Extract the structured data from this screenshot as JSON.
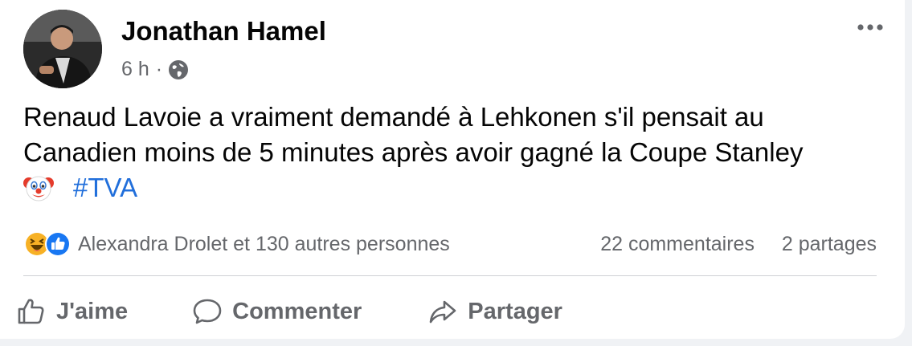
{
  "post": {
    "author": "Jonathan Hamel",
    "time": "6 h",
    "separator": "·",
    "text_line1": "Renaud Lavoie a vraiment demandé à Lehkonen s'il pensait au",
    "text_line2": "Canadien moins de 5 minutes après avoir gagné la Coupe Stanley",
    "hashtag": "#TVA"
  },
  "reactions": {
    "names": "Alexandra Drolet et 130 autres personnes",
    "comments": "22 commentaires",
    "shares": "2 partages"
  },
  "actions": {
    "like": "J'aime",
    "comment": "Commenter",
    "share": "Partager"
  },
  "icons": {
    "privacy": "globe-icon",
    "menu": "more-options-icon",
    "emoji": "clown-emoji",
    "reaction_haha": "haha-reaction-icon",
    "reaction_like": "like-reaction-icon"
  },
  "colors": {
    "hashtag": "#216fdb",
    "secondary_text": "#65676b",
    "like_blue": "#1877f2",
    "haha_yellow": "#f7b125"
  }
}
